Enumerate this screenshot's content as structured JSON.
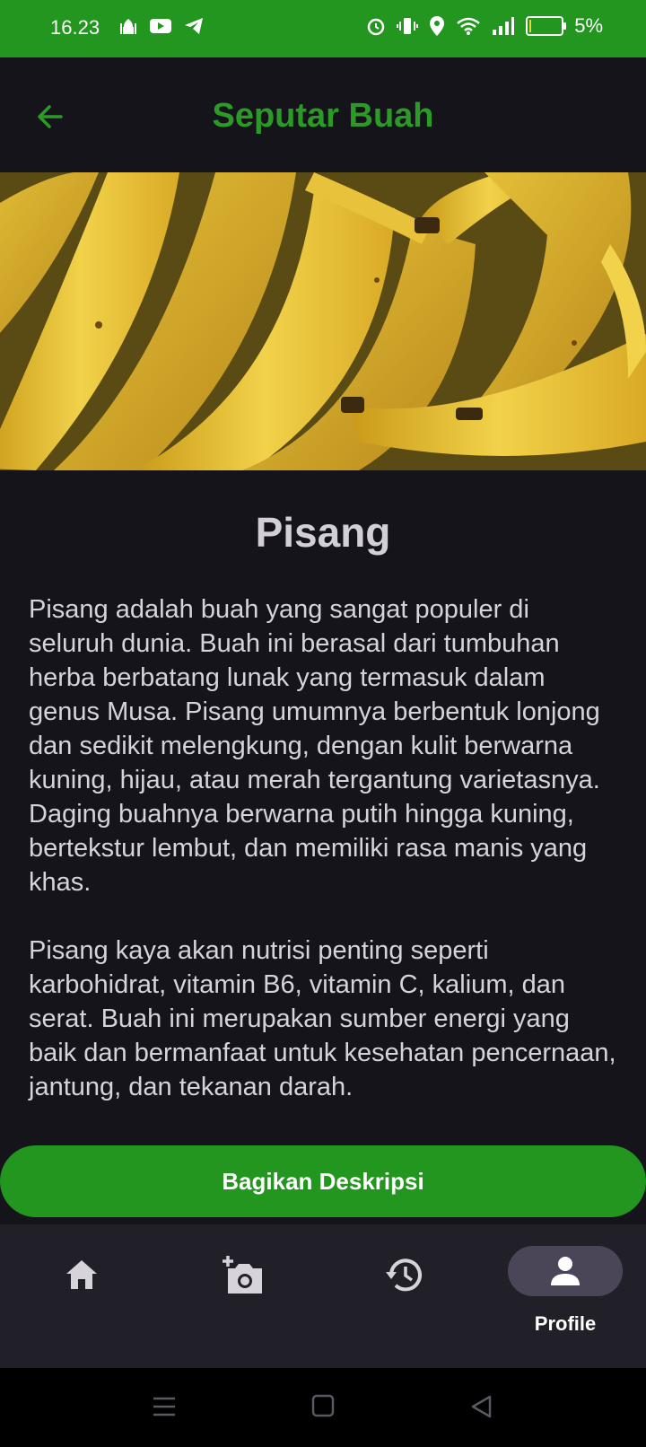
{
  "status_bar": {
    "time": "16.23",
    "battery_text": "5%",
    "battery_level": 0.05,
    "left_icons": [
      "mosque-icon",
      "youtube-icon",
      "telegram-icon"
    ],
    "right_icons": [
      "alarm-icon",
      "vibrate-icon",
      "location-icon",
      "wifi-icon",
      "signal-icon",
      "battery-icon"
    ]
  },
  "app_bar": {
    "title": "Seputar Buah",
    "back_icon": "arrow-left-icon"
  },
  "hero": {
    "subject": "bananas"
  },
  "article": {
    "title": "Pisang",
    "paragraphs": [
      "Pisang adalah buah yang sangat populer di seluruh dunia. Buah ini berasal dari tumbuhan herba berbatang lunak yang termasuk dalam genus Musa. Pisang umumnya berbentuk lonjong dan sedikit melengkung, dengan kulit berwarna kuning, hijau, atau merah tergantung varietasnya. Daging buahnya berwarna putih hingga kuning, bertekstur lembut, dan memiliki rasa manis yang khas.",
      "Pisang kaya akan nutrisi penting seperti karbohidrat, vitamin B6, vitamin C, kalium, dan serat. Buah ini merupakan sumber energi yang baik dan bermanfaat untuk kesehatan pencernaan, jantung, dan tekanan darah."
    ]
  },
  "share_button": {
    "label": "Bagikan Deskripsi"
  },
  "bottom_nav": {
    "items": [
      {
        "icon": "home-icon",
        "label": ""
      },
      {
        "icon": "add-photo-icon",
        "label": ""
      },
      {
        "icon": "history-icon",
        "label": ""
      },
      {
        "icon": "profile-icon",
        "label": "Profile",
        "active": true
      }
    ]
  },
  "colors": {
    "accent_green": "#23961f",
    "title_green": "#2c9a26",
    "background": "#16141b",
    "nav_background": "#211f27",
    "active_pill": "#4a4657"
  },
  "system_nav": [
    "menu-icon",
    "home-square-icon",
    "back-triangle-icon"
  ]
}
